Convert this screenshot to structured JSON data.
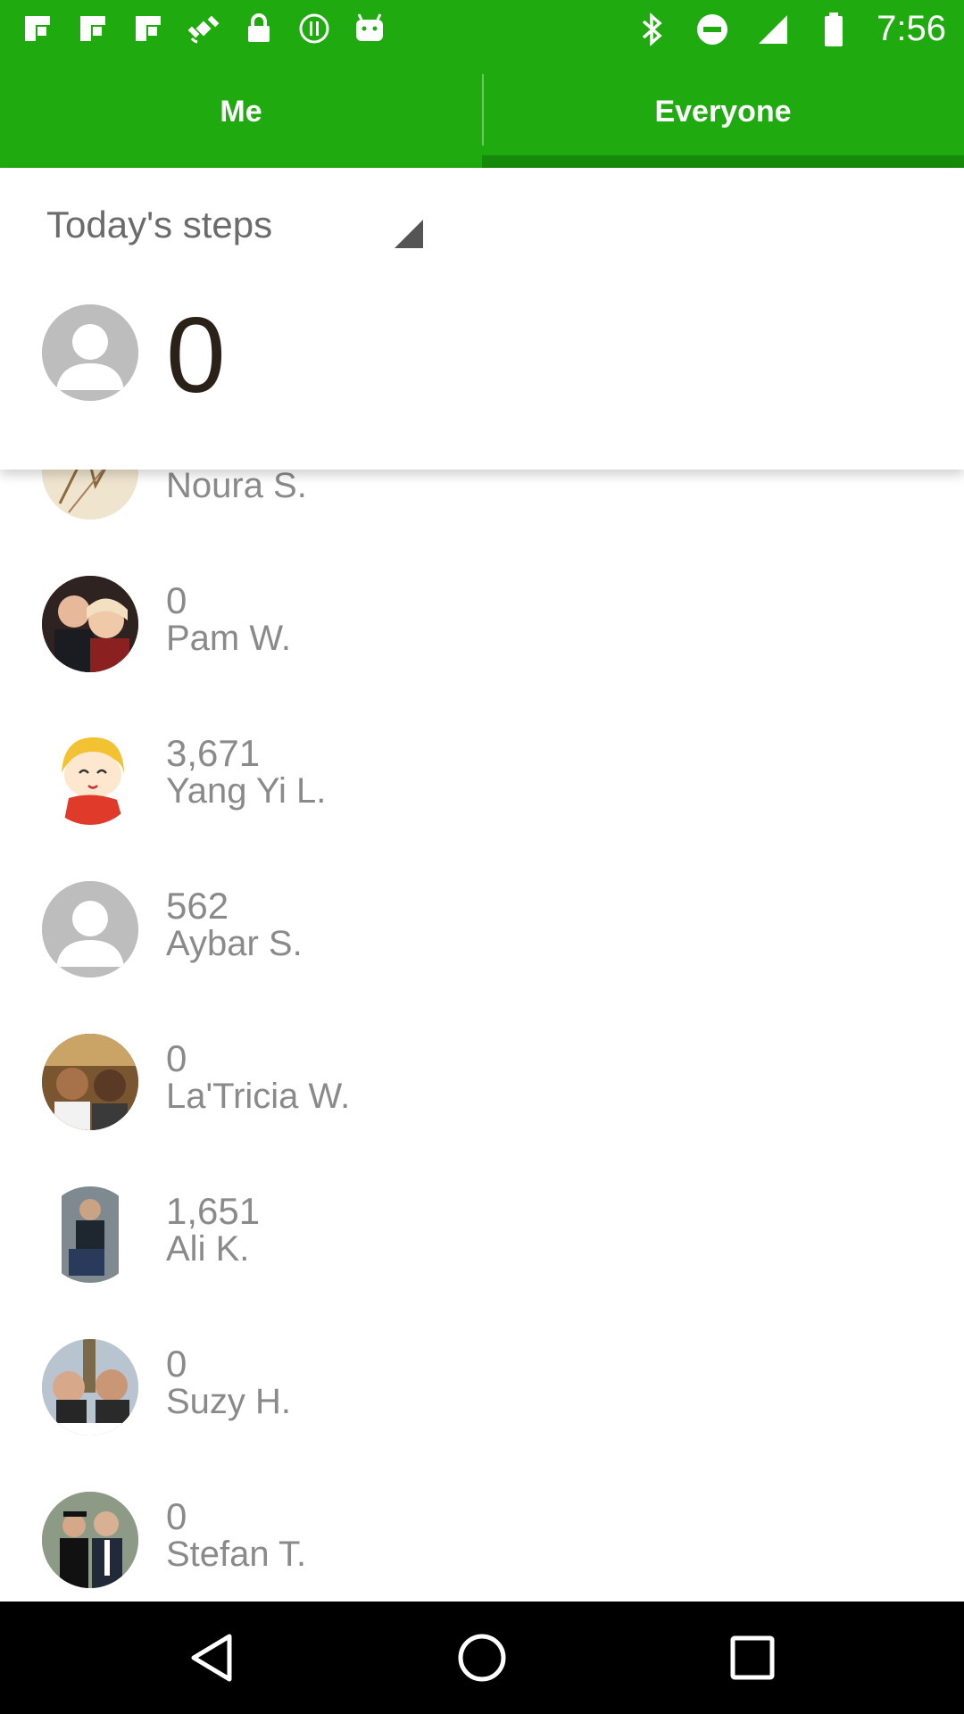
{
  "status_bar": {
    "time": "7:56",
    "left_icons": [
      "flipboard-icon",
      "flipboard-icon",
      "flipboard-icon",
      "satellite-icon",
      "lock-icon",
      "info-icon",
      "android-icon"
    ],
    "right_icons": [
      "bluetooth-icon",
      "do-not-disturb-icon",
      "signal-icon",
      "battery-icon"
    ]
  },
  "tabs": [
    {
      "label": "Me",
      "active": false
    },
    {
      "label": "Everyone",
      "active": true
    }
  ],
  "filter": {
    "label": "Today's steps"
  },
  "me": {
    "steps": "0",
    "avatar": "default-avatar"
  },
  "list": [
    {
      "steps": "",
      "name": "Noura S.",
      "avatar": "sketch-photo"
    },
    {
      "steps": "0",
      "name": "Pam W.",
      "avatar": "couple-photo"
    },
    {
      "steps": "3,671",
      "name": "Yang Yi L.",
      "avatar": "cartoon-girl"
    },
    {
      "steps": "562",
      "name": "Aybar S.",
      "avatar": "default-avatar"
    },
    {
      "steps": "0",
      "name": "La'Tricia W.",
      "avatar": "couple-photo"
    },
    {
      "steps": "1,651",
      "name": "Ali K.",
      "avatar": "person-photo"
    },
    {
      "steps": "0",
      "name": "Suzy H.",
      "avatar": "couple-photo"
    },
    {
      "steps": "0",
      "name": "Stefan T.",
      "avatar": "graduation-photo"
    }
  ],
  "colors": {
    "brand_green": "#1faa0f",
    "active_tab_indicator": "#168a0a",
    "text_gray": "#8a8a8a",
    "steps_dark": "#2a2118"
  },
  "nav": [
    "back-icon",
    "home-icon",
    "recents-icon"
  ]
}
